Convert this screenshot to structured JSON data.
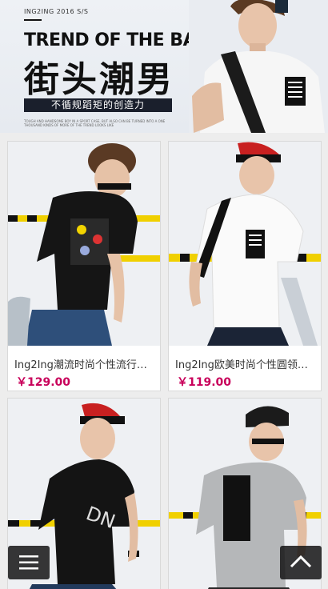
{
  "banner": {
    "tag": "ING2ING 2016 S/S",
    "headline": "TREND OF THE BAD BOYS",
    "headline_cn": "街头潮男",
    "slogan": "不循规蹈矩的创造力",
    "fine_print": "TOUGH AND HANDSOME BOY IN A SPORT CASE, BUT ALSO CAN BE TURNED INTO A ONE THOUSAND KINDS OF MORE OF THE TREND LOOKS LIKE"
  },
  "products": [
    {
      "title": "Ing2Ing潮流时尚个性流行字...",
      "price": "￥129.00"
    },
    {
      "title": "Ing2Ing欧美时尚个性圆领潮...",
      "price": "￥119.00"
    },
    {
      "title": "",
      "price": ""
    },
    {
      "title": "",
      "price": ""
    }
  ],
  "controls": {
    "menu_icon": "hamburger-icon",
    "top_icon": "chevron-up-icon"
  },
  "colors": {
    "price": "#c8005a",
    "slogan_bg": "#1a1f2c",
    "fab_bg": "#141414"
  }
}
